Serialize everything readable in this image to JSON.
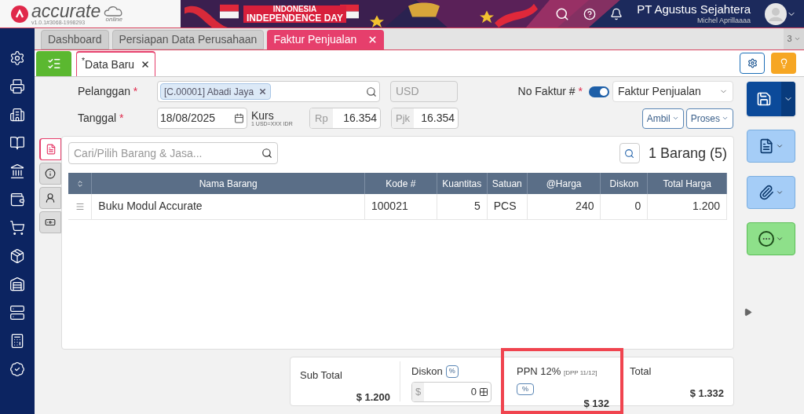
{
  "header": {
    "logo": "accurate",
    "logo_sub": "online",
    "version": "v1.0.1#3068-1998293",
    "banner_lines": [
      "INDONESIA",
      "INDEPENDENCE DAY"
    ],
    "company": "PT Agustus Sejahtera",
    "user": "Michel Aprillaaaa"
  },
  "tabs": [
    {
      "label": "Dashboard",
      "selected": false,
      "closable": false
    },
    {
      "label": "Persiapan Data Perusahaan",
      "selected": false,
      "closable": false
    },
    {
      "label": "Faktur Penjualan",
      "selected": true,
      "closable": true
    }
  ],
  "tab_count": "3",
  "subtabs": [
    {
      "label": "$^{*}$Data Baru",
      "selected": true
    }
  ],
  "form": {
    "customer_label": "Pelanggan",
    "customer_required": "*",
    "date_required": "*",
    "invoice_required": "*",
    "customer_chip": "[C.00001] Abadi Jaya",
    "currency": "USD",
    "date_label": "Tanggal",
    "date": "18/08/2025",
    "rate_label": "Kurs",
    "rate_note": "1 USD=XXX IDR",
    "rate_prefix": "Rp",
    "rate": "16.354",
    "tax_prefix": "Pjk",
    "tax_rate": "16.354",
    "invoice_label": "No Faktur #",
    "auto_number": {
      "on": true
    },
    "invoice_type": "Faktur Penjualan",
    "buttons": [
      "Ambil",
      "Proses"
    ]
  },
  "side_tabs": [
    {
      "kind": "detail",
      "selected": true
    },
    {
      "kind": "info",
      "selected": false
    },
    {
      "kind": "customer",
      "selected": false
    },
    {
      "kind": "payment",
      "selected": false
    }
  ],
  "items": {
    "search_placeholder": "Cari/Pilih Barang & Jasa...",
    "count": "1 Barang (5)",
    "columns": [
      "Nama Barang",
      "Kode #",
      "Kuantitas",
      "Satuan",
      "@Harga",
      "Diskon",
      "Total Harga"
    ],
    "rows": [
      {
        "cells": [
          "Buku Modul Accurate",
          "100021",
          "5",
          "PCS",
          "240",
          "0",
          "1.200"
        ]
      }
    ]
  },
  "summary": {
    "subtotal_label": "Sub Total",
    "subtotal": "$ 1.200",
    "discount_label": "Diskon",
    "discount_badge": "%",
    "discount_prefix": "$",
    "discount": "0",
    "tax_label": "PPN 12%",
    "tax_note": "[DPP 11/12]",
    "tax_badge": "%",
    "tax": "$ 132",
    "tax_highlighted": true,
    "total_label": "Total",
    "total": "$ 1.332"
  }
}
